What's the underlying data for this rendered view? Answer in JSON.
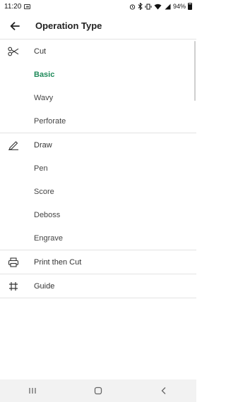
{
  "status_bar": {
    "time": "11:20",
    "battery": "94%"
  },
  "app_bar": {
    "title": "Operation Type"
  },
  "groups": [
    {
      "label": "Cut",
      "icon": "scissors-icon",
      "options": [
        "Basic",
        "Wavy",
        "Perforate"
      ],
      "selected": "Basic"
    },
    {
      "label": "Draw",
      "icon": "pen-icon",
      "options": [
        "Pen",
        "Score",
        "Deboss",
        "Engrave"
      ]
    },
    {
      "label": "Print then Cut",
      "icon": "printer-icon",
      "options": []
    },
    {
      "label": "Guide",
      "icon": "hash-icon",
      "options": []
    }
  ],
  "colors": {
    "accent": "#1f8a5a",
    "divider": "#e3e3e3",
    "nav_bar": "#f2f2f2"
  }
}
